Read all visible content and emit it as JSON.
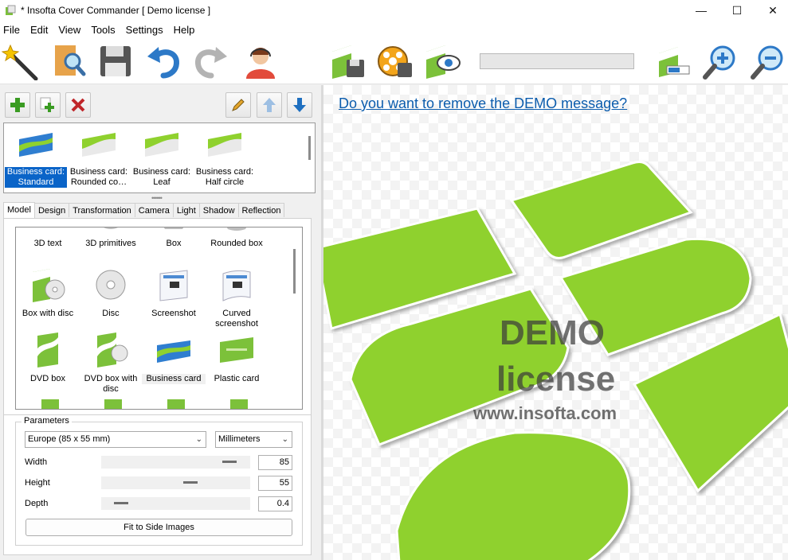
{
  "window": {
    "title": "* Insofta Cover Commander [ Demo license ]"
  },
  "menu": [
    "File",
    "Edit",
    "View",
    "Tools",
    "Settings",
    "Help"
  ],
  "presets": [
    {
      "label": "Business card: Standard",
      "selected": true
    },
    {
      "label": "Business card: Rounded co…",
      "selected": false
    },
    {
      "label": "Business card: Leaf",
      "selected": false
    },
    {
      "label": "Business card: Half circle",
      "selected": false
    }
  ],
  "tabs": [
    "Model",
    "Design",
    "Transformation",
    "Camera",
    "Light",
    "Shadow",
    "Reflection"
  ],
  "models": [
    {
      "label": "3D text"
    },
    {
      "label": "3D primitives"
    },
    {
      "label": "Box"
    },
    {
      "label": "Rounded box"
    },
    {
      "label": "Box with disc"
    },
    {
      "label": "Disc"
    },
    {
      "label": "Screenshot"
    },
    {
      "label": "Curved screenshot"
    },
    {
      "label": "DVD box"
    },
    {
      "label": "DVD box with disc"
    },
    {
      "label": "Business card"
    },
    {
      "label": "Plastic card"
    }
  ],
  "parameters": {
    "title": "Parameters",
    "size_preset": "Europe (85 x 55 mm)",
    "units": "Millimeters",
    "width_label": "Width",
    "width_value": "85",
    "height_label": "Height",
    "height_value": "55",
    "depth_label": "Depth",
    "depth_value": "0.4",
    "fit_button": "Fit to Side Images"
  },
  "preview": {
    "demo_link": "Do you want to remove the DEMO message?",
    "watermark_line1": "DEMO",
    "watermark_line2": "license",
    "watermark_line3": "www.insofta.com"
  },
  "colors": {
    "card_green": "#8fd12e",
    "accent_blue": "#0a64c8",
    "link": "#0b5cad"
  }
}
